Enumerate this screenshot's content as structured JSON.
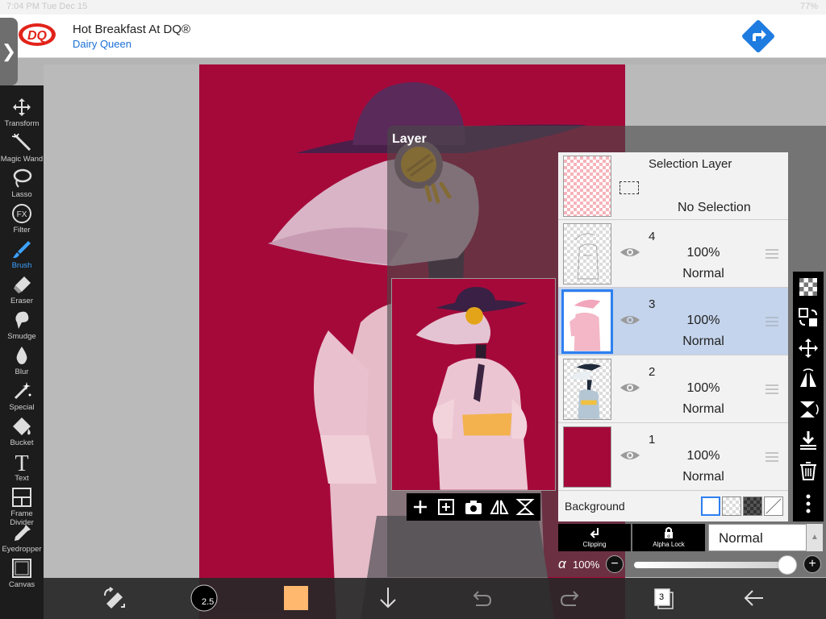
{
  "status_bar": {
    "time": "7:04 PM   Tue Dec 15",
    "battery": "77%"
  },
  "ad": {
    "logo_text": "DQ",
    "title": "Hot Breakfast At DQ®",
    "subtitle": "Dairy Queen",
    "brand_color": "#e2231a",
    "direction_color": "#1e7be0"
  },
  "panel_toggle": {
    "icon": "chevron-right-icon",
    "glyph": "❯"
  },
  "toolbar": {
    "tools": [
      {
        "label": "Transform",
        "icon": "move-arrows-icon"
      },
      {
        "label": "Magic Wand",
        "icon": "magic-wand-icon"
      },
      {
        "label": "Lasso",
        "icon": "lasso-icon"
      },
      {
        "label": "Filter",
        "icon": "fx-icon",
        "glyph": "FX"
      },
      {
        "label": "Brush",
        "icon": "brush-icon"
      },
      {
        "label": "Eraser",
        "icon": "eraser-icon"
      },
      {
        "label": "Smudge",
        "icon": "smudge-icon"
      },
      {
        "label": "Blur",
        "icon": "droplet-icon"
      },
      {
        "label": "Special",
        "icon": "special-wand-icon"
      },
      {
        "label": "Bucket",
        "icon": "bucket-icon"
      },
      {
        "label": "Text",
        "icon": "text-icon",
        "glyph": "T"
      },
      {
        "label": "Frame Divider",
        "icon": "frame-divider-icon"
      },
      {
        "label": "Eyedropper",
        "icon": "eyedropper-icon"
      },
      {
        "label": "Canvas",
        "icon": "canvas-icon"
      }
    ],
    "active": "Brush",
    "active_color": "#3da2ff"
  },
  "canvas": {
    "background_color": "#a5093a"
  },
  "layer_panel": {
    "title": "Layer",
    "selection_layer": {
      "title": "Selection Layer",
      "status": "No Selection"
    },
    "layers": [
      {
        "number": "4",
        "opacity": "100%",
        "mode": "Normal",
        "visible": true,
        "selected": false
      },
      {
        "number": "3",
        "opacity": "100%",
        "mode": "Normal",
        "visible": true,
        "selected": true
      },
      {
        "number": "2",
        "opacity": "100%",
        "mode": "Normal",
        "visible": true,
        "selected": false
      },
      {
        "number": "1",
        "opacity": "100%",
        "mode": "Normal",
        "visible": true,
        "selected": false
      }
    ],
    "background": {
      "label": "Background",
      "options": [
        "white",
        "checker",
        "dark-checker",
        "none"
      ],
      "selected": "white"
    },
    "selected_color": "#2e7ff1"
  },
  "layer_tools": [
    "checker-new-layer-icon",
    "swap-layer-icon",
    "move-layer-icon",
    "flip-horizontal-icon",
    "flip-vertical-icon",
    "merge-down-icon",
    "trash-icon",
    "more-vertical-icon"
  ],
  "preview_toolbar": [
    "add-layer-icon",
    "add-special-layer-icon",
    "camera-icon",
    "flip-icon",
    "mirror-icon"
  ],
  "blend": {
    "clipping_label": "Clipping",
    "alpha_lock_label": "Alpha Lock",
    "mode": "Normal",
    "alpha_symbol": "α",
    "alpha_value": "100%",
    "alpha_level": 1.0,
    "minus": "−",
    "plus": "+"
  },
  "bottom_bar": {
    "brush_size": "2.5",
    "color": "#ffb86e",
    "layer_count": "3",
    "icons": [
      "transform-selection-icon",
      "brush-size-icon",
      "color-swatch-icon",
      "down-arrow-icon",
      "undo-icon",
      "redo-icon",
      "layers-icon",
      "back-arrow-icon"
    ]
  }
}
